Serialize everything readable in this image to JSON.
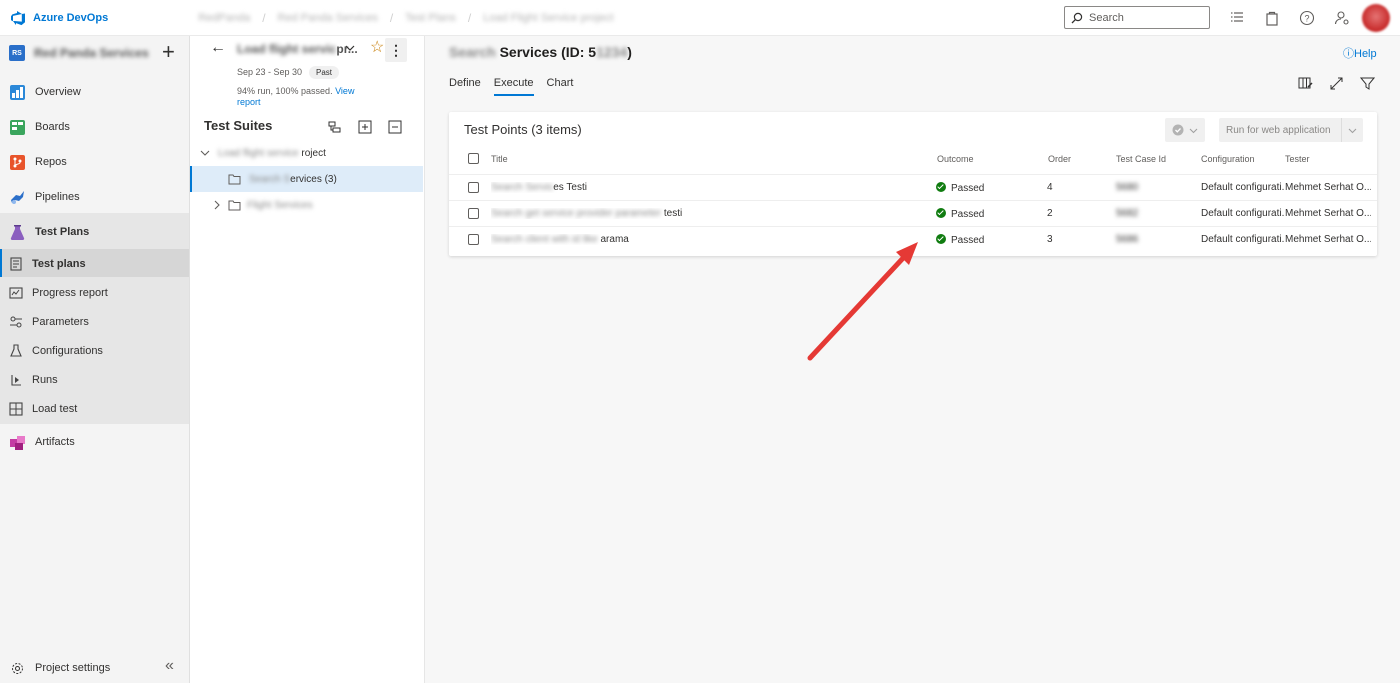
{
  "topbar": {
    "brand": "Azure DevOps",
    "breadcrumbs": [
      "RedPanda",
      "Red Panda Services",
      "Test Plans",
      "Load Flight Service project"
    ],
    "search_placeholder": "Search"
  },
  "project": {
    "badge": "RS",
    "name": "Red Panda Services"
  },
  "nav": {
    "items": [
      {
        "label": "Overview"
      },
      {
        "label": "Boards"
      },
      {
        "label": "Repos"
      },
      {
        "label": "Pipelines"
      },
      {
        "label": "Test Plans"
      },
      {
        "label": "Test plans"
      },
      {
        "label": "Progress report"
      },
      {
        "label": "Parameters"
      },
      {
        "label": "Configurations"
      },
      {
        "label": "Runs"
      },
      {
        "label": "Load test"
      },
      {
        "label": "Artifacts"
      }
    ],
    "settings_label": "Project settings",
    "colors": {
      "overview": "#2b88d8",
      "boards": "#3aa55d",
      "repos": "#e8542b",
      "pipelines": "#2b6fc9",
      "testplans": "#8b5fbf",
      "artifacts": "#c43ca3"
    }
  },
  "plan": {
    "name_hidden": "Load flight servic",
    "name_visible": "pr...",
    "dates": "Sep 23 - Sep 30",
    "status": "Past",
    "run_info": "94% run, 100% passed.",
    "view_report": "View report"
  },
  "suites": {
    "title": "Test Suites",
    "tree": [
      {
        "label_hidden": "Load flight service ",
        "label_visible": "roject"
      },
      {
        "label_hidden": "Search S",
        "label_visible": "ervices (3)"
      },
      {
        "label_hidden": "Flight Services",
        "label_visible": ""
      }
    ]
  },
  "main": {
    "suite_title_visible": "Services (ID: 5",
    "suite_title_hidden": "Search",
    "suite_id_hidden": "1234",
    "suite_title_end": ")",
    "help": "Help",
    "tabs": [
      "Define",
      "Execute",
      "Chart"
    ],
    "active_tab": "Execute"
  },
  "test_points": {
    "title": "Test Points (3 items)",
    "run_button": "Run for web application",
    "columns": [
      "Title",
      "Outcome",
      "Order",
      "Test Case Id",
      "Configuration",
      "Tester"
    ],
    "rows": [
      {
        "title_hidden": "Search Servic",
        "title_visible": "es Testi",
        "outcome": "Passed",
        "order": "4",
        "case_id": "5680",
        "configuration": "Default configurati...",
        "tester": "Mehmet Serhat O..."
      },
      {
        "title_hidden": "Search get service provider parameter",
        "title_visible": "testi",
        "outcome": "Passed",
        "order": "2",
        "case_id": "5682",
        "configuration": "Default configurati...",
        "tester": "Mehmet Serhat O..."
      },
      {
        "title_hidden": "Search client with id like",
        "title_visible": "arama",
        "outcome": "Passed",
        "order": "3",
        "case_id": "5686",
        "configuration": "Default configurati...",
        "tester": "Mehmet Serhat O..."
      }
    ]
  }
}
